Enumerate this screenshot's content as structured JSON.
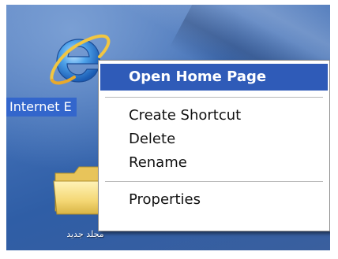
{
  "desktop": {
    "icons": [
      {
        "label": "Internet Explorer",
        "visible_label": "Internet E",
        "icon": "internet-explorer-icon"
      },
      {
        "label": "مجلد جديد",
        "icon": "folder-icon"
      }
    ]
  },
  "context_menu": {
    "items": [
      {
        "label": "Open Home Page",
        "bold": true,
        "highlighted": true
      },
      {
        "separator": true
      },
      {
        "label": "Create Shortcut"
      },
      {
        "label": "Delete"
      },
      {
        "label": "Rename"
      },
      {
        "separator": true
      },
      {
        "label": "Properties"
      }
    ]
  },
  "colors": {
    "selection": "#2f5bb8",
    "desktop": "#3f6db4",
    "menu_background": "#ffffff"
  }
}
